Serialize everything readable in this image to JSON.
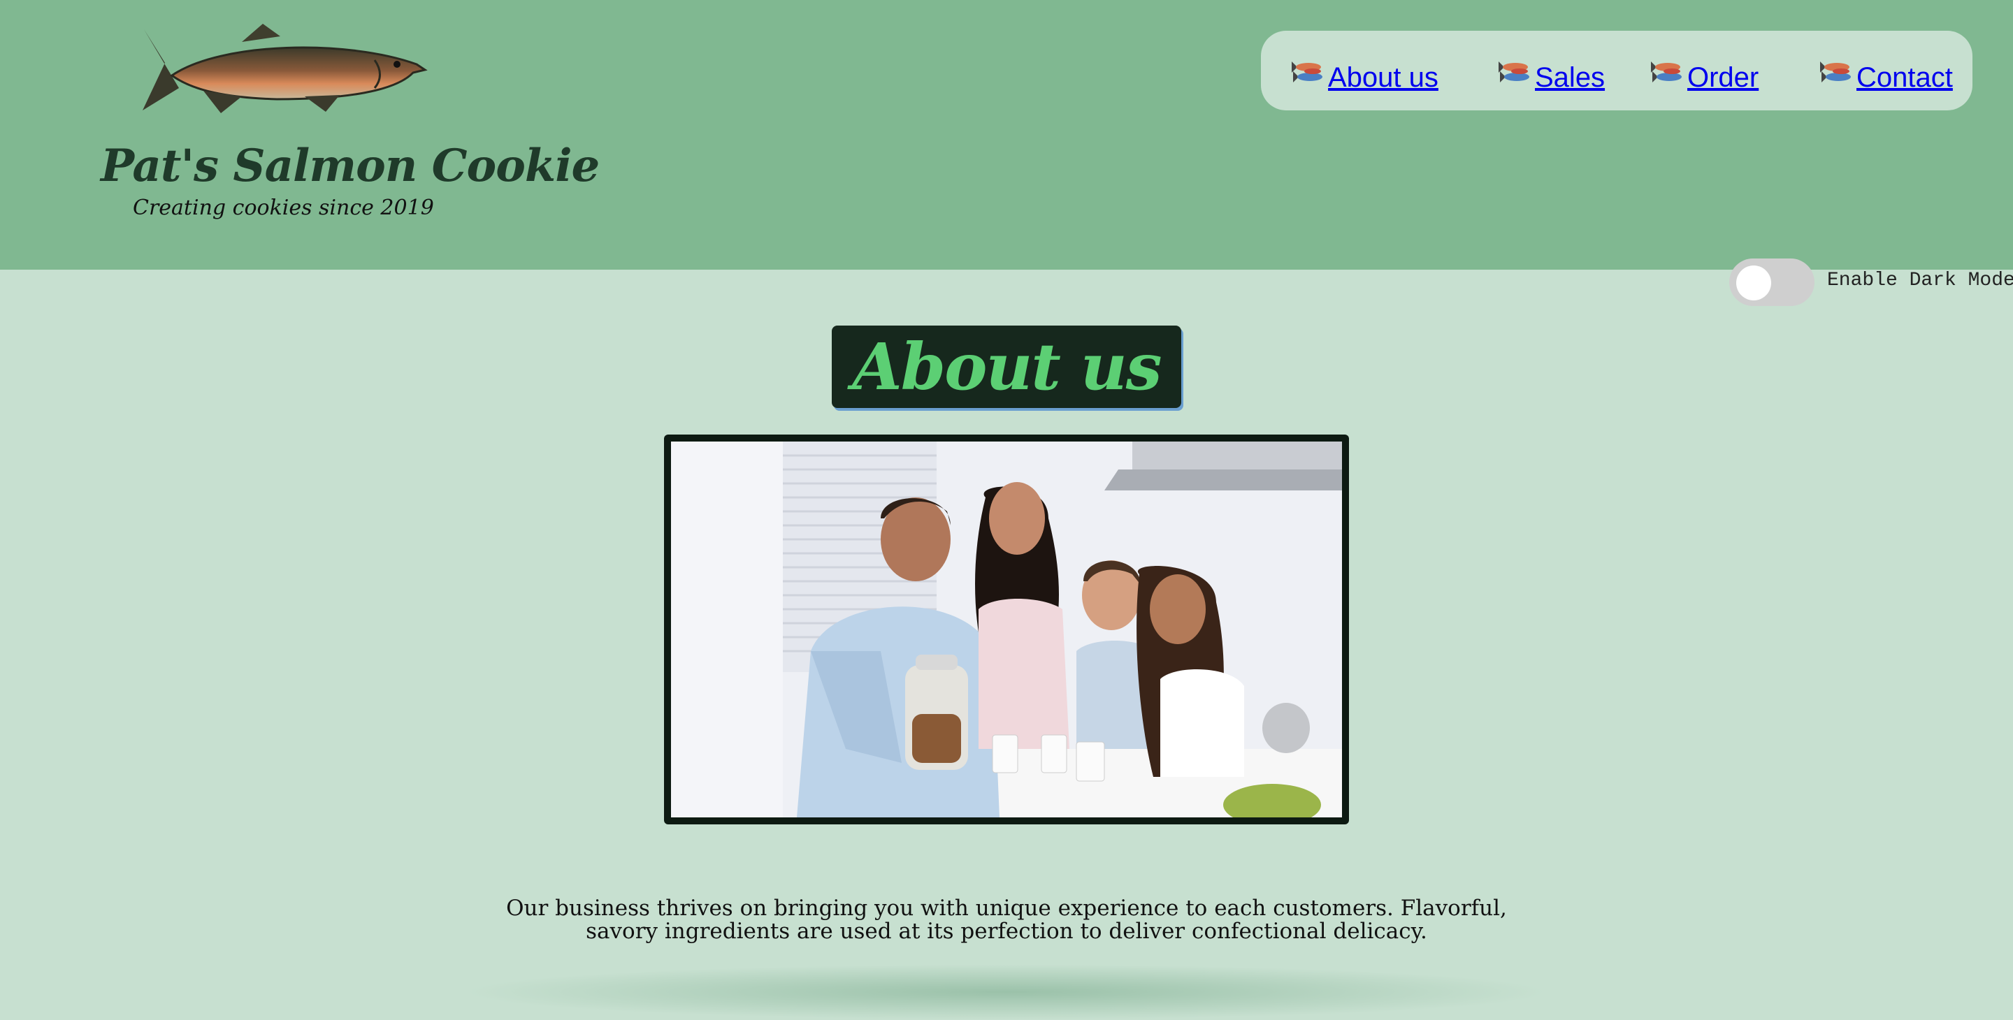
{
  "site": {
    "title": "Pat's Salmon Cookie",
    "tagline": "Creating cookies since 2019"
  },
  "nav": {
    "items": [
      {
        "label": " About us",
        "icon": "fish-icon"
      },
      {
        "label": "Sales",
        "icon": "fish-icon"
      },
      {
        "label": "Order",
        "icon": "fish-icon"
      },
      {
        "label": "Contact",
        "icon": "fish-icon"
      }
    ]
  },
  "dark_mode": {
    "label": "Enable Dark Mode!",
    "enabled": false
  },
  "main": {
    "heading": "About us",
    "photo": "family-photo",
    "description": "Our business thrives on bringing you with unique experience to each customers. Flavorful, savory ingredients are used at its perfection to deliver confectional delicacy."
  },
  "colors": {
    "header_bg": "#80b891",
    "page_bg": "#c7e0d0",
    "heading_bg": "#16281d",
    "heading_text": "#5ccf74",
    "link": "#0000ee"
  }
}
